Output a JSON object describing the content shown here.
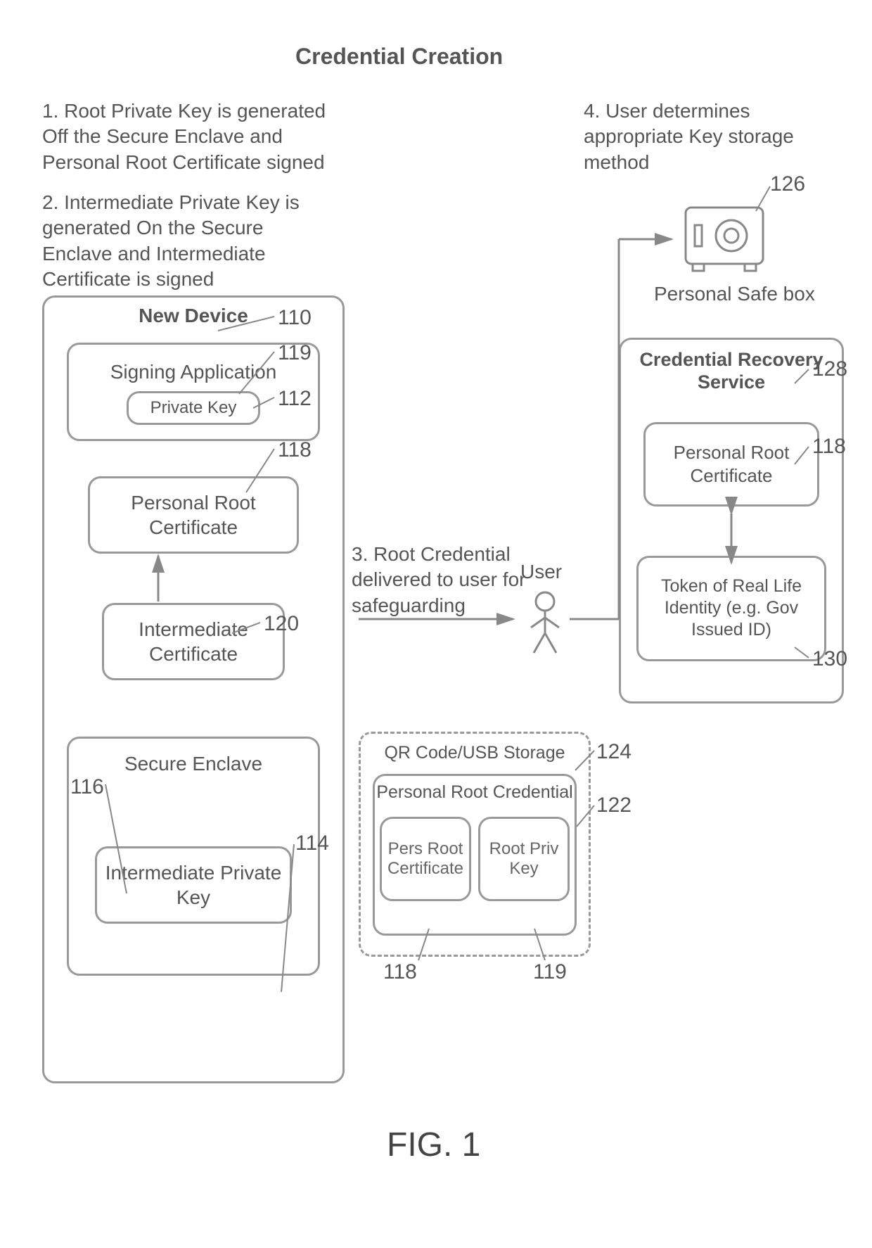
{
  "title": "Credential Creation",
  "steps": {
    "step1": "1. Root Private Key is generated Off the Secure Enclave and Personal Root Certificate signed",
    "step2": "2. Intermediate Private Key is generated On the Secure Enclave and Intermediate Certificate is signed",
    "step3": "3. Root Credential delivered to user for safeguarding",
    "step4": "4. User determines appropriate Key storage method"
  },
  "device": {
    "title": "New Device",
    "signing_app": "Signing Application",
    "private_key": "Private Key",
    "personal_root_cert": "Personal Root Certificate",
    "intermediate_cert": "Intermediate Certificate",
    "secure_enclave": "Secure Enclave",
    "intermediate_priv_key": "Intermediate Private Key"
  },
  "storage": {
    "title": "QR Code/USB Storage",
    "credential": "Personal Root Credential",
    "pers_root_cert": "Pers Root Certificate",
    "root_priv_key": "Root Priv Key"
  },
  "user_label": "User",
  "safe_label": "Personal Safe box",
  "recovery": {
    "title": "Credential Recovery Service",
    "personal_root_cert": "Personal Root Certificate",
    "token": "Token of Real Life Identity (e.g. Gov Issued ID)"
  },
  "refs": {
    "r110": "110",
    "r112": "112",
    "r114": "114",
    "r116": "116",
    "r118a": "118",
    "r118b": "118",
    "r118c": "118",
    "r119a": "119",
    "r119b": "119",
    "r120": "120",
    "r122": "122",
    "r124": "124",
    "r126": "126",
    "r128": "128",
    "r130": "130"
  },
  "figure": "FIG. 1"
}
